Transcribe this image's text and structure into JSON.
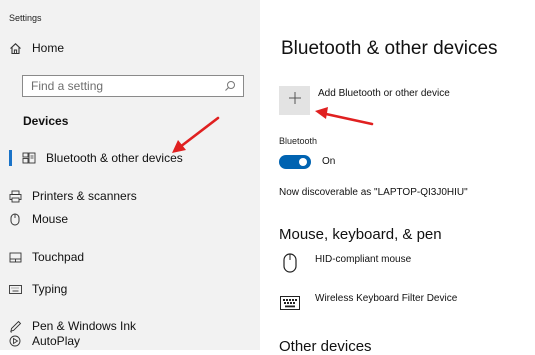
{
  "sidebar": {
    "app_title": "Settings",
    "home_label": "Home",
    "search_placeholder": "Find a setting",
    "section_title": "Devices",
    "items": [
      {
        "label": "Bluetooth & other devices",
        "icon": "bluetooth-devices-icon",
        "active": true
      },
      {
        "label": "Printers & scanners",
        "icon": "printer-icon"
      },
      {
        "label": "Mouse",
        "icon": "mouse-icon"
      },
      {
        "label": "Touchpad",
        "icon": "touchpad-icon"
      },
      {
        "label": "Typing",
        "icon": "keyboard-icon"
      },
      {
        "label": "Pen & Windows Ink",
        "icon": "pen-icon"
      },
      {
        "label": "AutoPlay",
        "icon": "autoplay-icon"
      }
    ]
  },
  "main": {
    "title": "Bluetooth & other devices",
    "add_device_label": "Add Bluetooth or other device",
    "bluetooth_label": "Bluetooth",
    "toggle_state": "On",
    "discoverable_text": "Now discoverable as \"LAPTOP-QI3J0HIU\"",
    "section_mouse": "Mouse, keyboard, & pen",
    "devices": [
      {
        "name": "HID-compliant mouse",
        "icon": "mouse-icon"
      },
      {
        "name": "Wireless Keyboard Filter Device",
        "icon": "keyboard-icon"
      }
    ],
    "section_other": "Other devices"
  },
  "colors": {
    "accent": "#0063b1",
    "annotation_arrow": "#e02020",
    "sidebar_bg": "#f2f2f2"
  }
}
